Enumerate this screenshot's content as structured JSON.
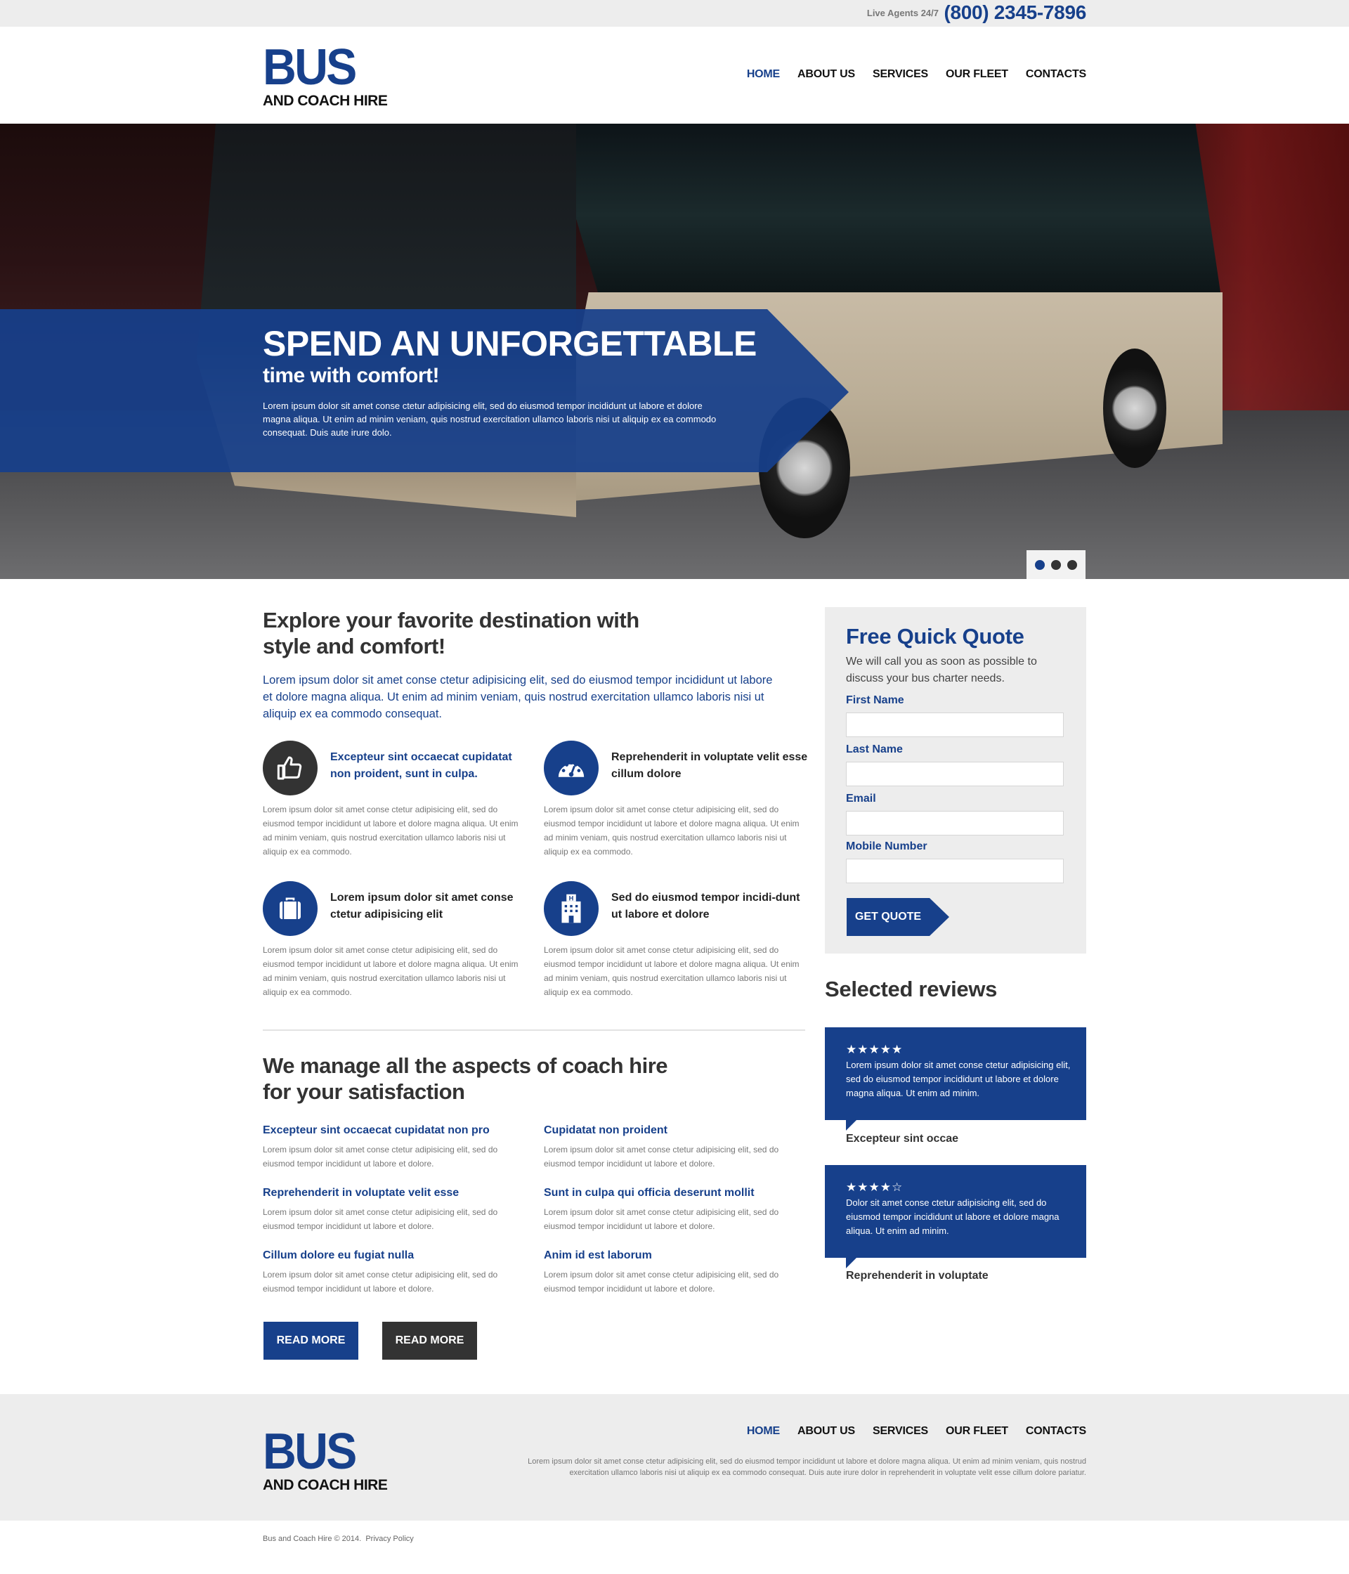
{
  "topbar": {
    "agents_label": "Live Agents 24/7",
    "phone": "(800) 2345-7896"
  },
  "brand": {
    "logo_main": "BUS",
    "logo_sub": "AND COACH HIRE",
    "accent_color": "#17408b",
    "dark_color": "#333333"
  },
  "nav": {
    "items": [
      {
        "label": "HOME",
        "active": true
      },
      {
        "label": "ABOUT US",
        "active": false
      },
      {
        "label": "SERVICES",
        "active": false
      },
      {
        "label": "OUR FLEET",
        "active": false
      },
      {
        "label": "CONTACTS",
        "active": false
      }
    ]
  },
  "hero": {
    "title": "SPEND AN UNFORGETTABLE",
    "subtitle": "time with comfort!",
    "text": "Lorem ipsum dolor sit amet conse ctetur adipisicing elit, sed do eiusmod tempor incididunt ut labore et dolore magna aliqua. Ut enim ad minim veniam, quis nostrud exercitation ullamco laboris nisi ut aliquip ex ea commodo consequat. Duis aute irure dolo.",
    "slides_total": 3,
    "active_slide": 1
  },
  "explore": {
    "heading_line1": "Explore your favorite destination with",
    "heading_line2": "style and comfort!",
    "lead": "Lorem ipsum dolor sit amet conse ctetur adipisicing elit, sed do eiusmod tempor incididunt ut labore et dolore magna aliqua. Ut enim ad minim veniam, quis nostrud exercitation ullamco laboris nisi ut aliquip ex ea commodo consequat.",
    "features": [
      {
        "icon": "thumbs-up-icon",
        "title": "Excepteur sint occaecat cupidatat non proident, sunt in culpa.",
        "text": "Lorem ipsum dolor sit amet conse ctetur adipisicing elit, sed do eiusmod tempor incididunt ut labore et dolore magna aliqua. Ut enim ad minim veniam, quis nostrud exercitation ullamco laboris nisi ut aliquip ex ea commodo."
      },
      {
        "icon": "speedometer-icon",
        "title": "Reprehenderit in voluptate velit esse cillum dolore",
        "text": "Lorem ipsum dolor sit amet conse ctetur adipisicing elit, sed do eiusmod tempor incididunt ut labore et dolore magna aliqua. Ut enim ad minim veniam, quis nostrud exercitation ullamco laboris nisi ut aliquip ex ea commodo."
      },
      {
        "icon": "suitcase-icon",
        "title": "Lorem ipsum dolor sit amet conse ctetur adipisicing elit",
        "text": "Lorem ipsum dolor sit amet conse ctetur adipisicing elit, sed do eiusmod tempor incididunt ut labore et dolore magna aliqua. Ut enim ad minim veniam, quis nostrud exercitation ullamco laboris nisi ut aliquip ex ea commodo."
      },
      {
        "icon": "hotel-icon",
        "title": "Sed do eiusmod tempor incidi-dunt ut labore et dolore",
        "text": "Lorem ipsum dolor sit amet conse ctetur adipisicing elit, sed do eiusmod tempor incididunt ut labore et dolore magna aliqua. Ut enim ad minim veniam, quis nostrud exercitation ullamco laboris nisi ut aliquip ex ea commodo."
      }
    ]
  },
  "manage": {
    "heading_line1": "We manage all the aspects of coach hire",
    "heading_line2": "for your satisfaction",
    "items": [
      {
        "title": "Excepteur sint occaecat cupidatat non pro",
        "text": "Lorem ipsum dolor sit amet conse ctetur adipisicing elit, sed do eiusmod tempor incididunt ut labore et dolore."
      },
      {
        "title": "Cupidatat non proident",
        "text": "Lorem ipsum dolor sit amet conse ctetur adipisicing elit, sed do eiusmod tempor incididunt ut labore et dolore."
      },
      {
        "title": "Reprehenderit in voluptate velit esse",
        "text": "Lorem ipsum dolor sit amet conse ctetur adipisicing elit, sed do eiusmod tempor incididunt ut labore et dolore."
      },
      {
        "title": "Sunt in culpa qui officia deserunt mollit",
        "text": "Lorem ipsum dolor sit amet conse ctetur adipisicing elit, sed do eiusmod tempor incididunt ut labore et dolore."
      },
      {
        "title": "Cillum dolore eu fugiat nulla",
        "text": "Lorem ipsum dolor sit amet conse ctetur adipisicing elit, sed do eiusmod tempor incididunt ut labore et dolore."
      },
      {
        "title": "Anim id est laborum",
        "text": "Lorem ipsum dolor sit amet conse ctetur adipisicing elit, sed do eiusmod tempor incididunt ut labore et dolore."
      }
    ],
    "button1_label": "READ MORE",
    "button2_label": "READ MORE"
  },
  "quote": {
    "title": "Free Quick Quote",
    "subtitle": "We will call you as soon as possible to discuss your bus charter needs.",
    "fields": [
      {
        "label": "First Name",
        "value": ""
      },
      {
        "label": "Last Name",
        "value": ""
      },
      {
        "label": "Email",
        "value": ""
      },
      {
        "label": "Mobile Number",
        "value": ""
      }
    ],
    "button_label": "GET QUOTE"
  },
  "reviews": {
    "heading": "Selected reviews",
    "items": [
      {
        "rating": 5,
        "stars": "★★★★★",
        "text": "Lorem ipsum dolor sit amet conse ctetur adipisicing elit, sed do eiusmod tempor incididunt ut labore et dolore magna aliqua. Ut enim ad minim.",
        "author": "Excepteur sint occae"
      },
      {
        "rating": 4,
        "stars": "★★★★☆",
        "text": "Dolor sit amet conse ctetur adipisicing elit, sed do eiusmod tempor incididunt ut labore et dolore magna aliqua. Ut enim ad minim.",
        "author": "Reprehenderit in voluptate"
      }
    ]
  },
  "footer": {
    "text": "Lorem ipsum dolor sit amet conse ctetur adipisicing elit, sed do eiusmod tempor incididunt ut labore et dolore magna aliqua. Ut enim ad minim veniam, quis nostrud exercitation ullamco laboris nisi ut aliquip ex ea commodo consequat. Duis aute irure dolor in reprehenderit in voluptate velit esse cillum dolore pariatur.",
    "copyright": "Bus and Coach Hire  © 2014.",
    "privacy_label": "Privacy Policy"
  }
}
